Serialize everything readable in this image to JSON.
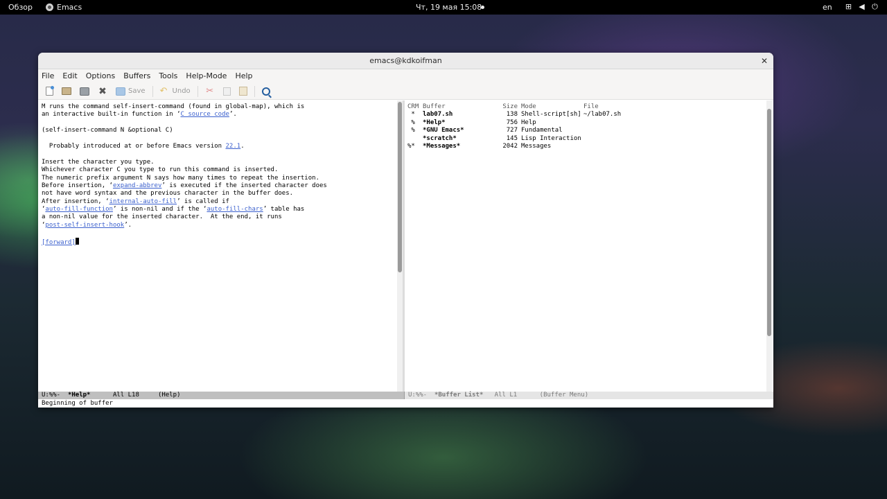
{
  "topbar": {
    "overview": "Обзор",
    "app_name": "Emacs",
    "clock": "Чт, 19 мая  15:08",
    "lang": "en"
  },
  "window": {
    "title": "emacs@kdkoifman"
  },
  "menu": [
    "File",
    "Edit",
    "Options",
    "Buffers",
    "Tools",
    "Help-Mode",
    "Help"
  ],
  "toolbar": {
    "save_label": "Save",
    "undo_label": "Undo"
  },
  "help_pane": {
    "line1_a": "M runs the command self-insert-command (found in global-map), which is",
    "line2_a": "an interactive built-in function in ‘",
    "line2_link": "C source code",
    "line2_b": "’.",
    "signature": "(self-insert-command N &optional C)",
    "intro_a": "  Probably introduced at or before Emacs version ",
    "intro_link": "22.1",
    "intro_b": ".",
    "p1": "Insert the character you type.",
    "p2": "Whichever character C you type to run this command is inserted.",
    "p3": "The numeric prefix argument N says how many times to repeat the insertion.",
    "p4_a": "Before insertion, ‘",
    "p4_link": "expand-abbrev",
    "p4_b": "’ is executed if the inserted character does",
    "p5": "not have word syntax and the previous character in the buffer does.",
    "p6_a": "After insertion, ‘",
    "p6_link": "internal-auto-fill",
    "p6_b": "’ is called if",
    "p7_a": "‘",
    "p7_link1": "auto-fill-function",
    "p7_b": "’ is non-nil and if the ‘",
    "p7_link2": "auto-fill-chars",
    "p7_c": "’ table has",
    "p8": "a non-nil value for the inserted character.  At the end, it runs",
    "p9_a": "‘",
    "p9_link": "post-self-insert-hook",
    "p9_b": "’.",
    "forward": "[forward]"
  },
  "buffer_list": {
    "headers": {
      "crm": "CRM",
      "buffer": "Buffer",
      "size": "Size",
      "mode": "Mode",
      "file": "File"
    },
    "rows": [
      {
        "crm": " *",
        "name": "lab07.sh",
        "size": "138",
        "mode": "Shell-script[sh]",
        "file": "~/lab07.sh"
      },
      {
        "crm": " %",
        "name": "*Help*",
        "size": "756",
        "mode": "Help",
        "file": ""
      },
      {
        "crm": " %",
        "name": "*GNU Emacs*",
        "size": "727",
        "mode": "Fundamental",
        "file": ""
      },
      {
        "crm": "  ",
        "name": "*scratch*",
        "size": "145",
        "mode": "Lisp Interaction",
        "file": ""
      },
      {
        "crm": "%*",
        "name": "*Messages*",
        "size": "2042",
        "mode": "Messages",
        "file": ""
      }
    ]
  },
  "modeline_left": {
    "status": "U:%%-  ",
    "buffer": "*Help*",
    "position": "      All L18     (Help)"
  },
  "modeline_right": {
    "status": "U:%%-  ",
    "buffer": "*Buffer List*",
    "position": "   All L1      (Buffer Menu)"
  },
  "minibuffer": "Beginning of buffer"
}
